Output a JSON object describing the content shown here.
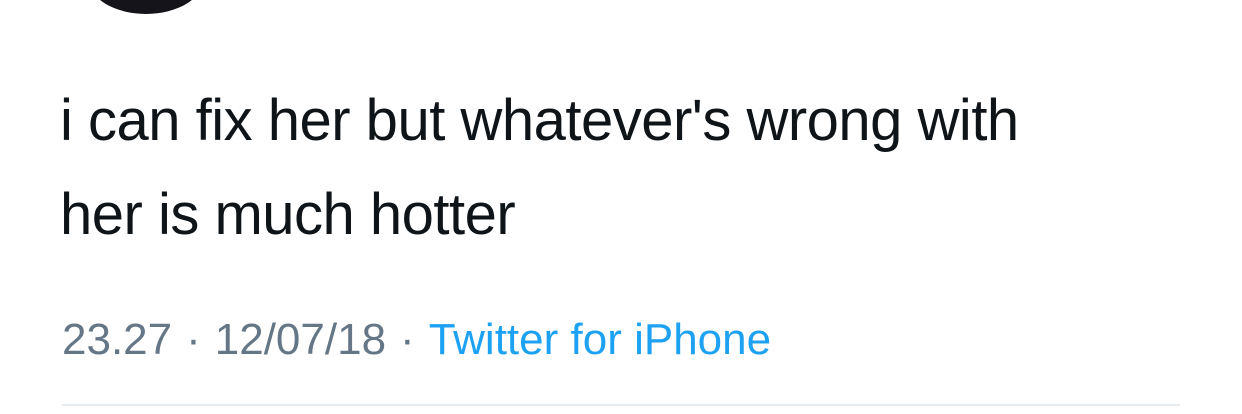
{
  "tweet": {
    "text_line_1": "i can fix her but whatever's wrong with",
    "text_line_2": "her is much hotter",
    "time": "23.27",
    "date": "12/07/18",
    "separator": "·",
    "source": "Twitter for iPhone"
  },
  "colors": {
    "text": "#0f1419",
    "muted": "#657786",
    "link": "#1da1f2",
    "divider": "#e6ecf0"
  }
}
